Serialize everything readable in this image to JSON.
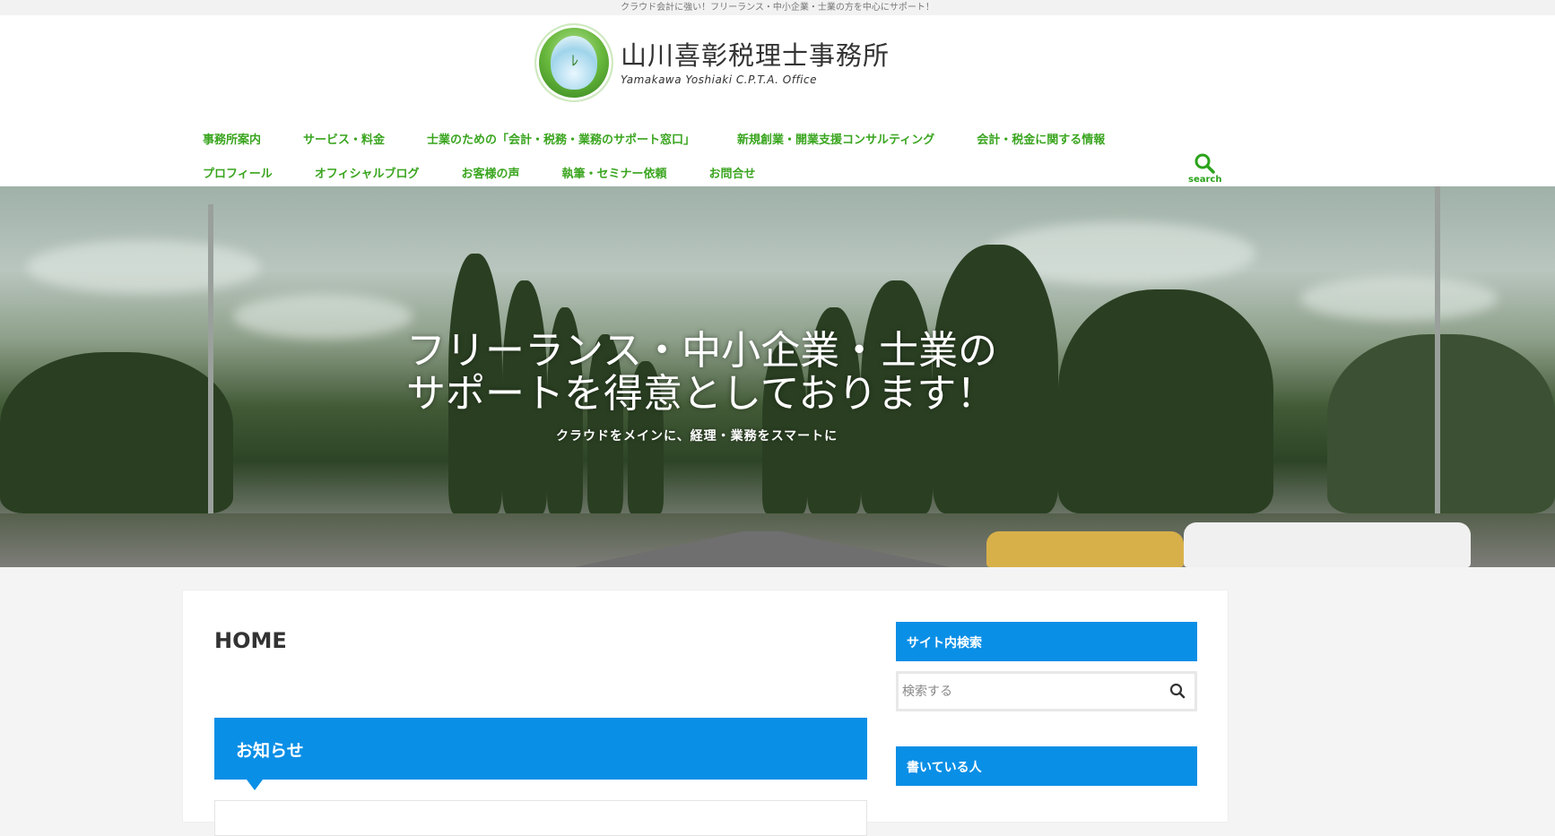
{
  "topbar": {
    "tagline": "クラウド会計に強い！フリーランス・中小企業・士業の方を中心にサポート！"
  },
  "logo": {
    "name_jp": "山川喜彰税理士事務所",
    "name_en": "Yamakawa Yoshiaki C.P.T.A. Office"
  },
  "nav": {
    "row1": [
      "事務所案内",
      "サービス・料金",
      "士業のための「会計・税務・業務のサポート窓口」",
      "新規創業・開業支援コンサルティング",
      "会計・税金に関する情報"
    ],
    "row2": [
      "プロフィール",
      "オフィシャルブログ",
      "お客様の声",
      "執筆・セミナー依頼",
      "お問合せ"
    ]
  },
  "search_toggle": {
    "label": "search"
  },
  "hero": {
    "title_line1": "フリーランス・中小企業・士業の",
    "title_line2": "サポートを得意としております！",
    "subtitle": "クラウドをメインに、経理・業務をスマートに"
  },
  "main": {
    "title": "HOME",
    "section_heading": "お知らせ"
  },
  "sidebar": {
    "search_title": "サイト内検索",
    "search_placeholder": "検索する",
    "author_title": "書いている人"
  },
  "colors": {
    "accent_green": "#3aa51f",
    "accent_blue": "#0a8fe6"
  }
}
